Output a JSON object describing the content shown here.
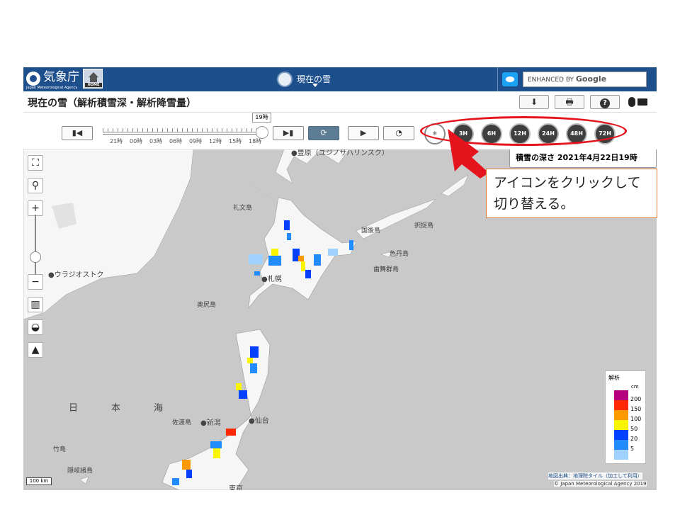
{
  "header": {
    "agency_name": "気象庁",
    "agency_sub": "Japan Meteorological Agency",
    "home_label": "HOME",
    "center_title": "現在の雪",
    "search_prefix": "ENHANCED BY",
    "search_brand": "Google"
  },
  "titlebar": {
    "page_title": "現在の雪（解析積雪深・解析降雪量）",
    "download_icon": "⬇",
    "print_icon": "🖶",
    "help_icon": "?"
  },
  "timebar": {
    "current_time_label": "19時",
    "tick_labels": [
      "21時",
      "00時",
      "03時",
      "06時",
      "09時",
      "12時",
      "15時",
      "18時"
    ],
    "content_buttons": [
      "",
      "3H",
      "6H",
      "12H",
      "24H",
      "48H",
      "72H"
    ]
  },
  "map": {
    "info_box": "積雪の深さ 2021年4月22日19時",
    "places": {
      "toyohara": "●豊原（ユジノサハリンスク）",
      "rebun": "礼文島",
      "kunashiri": "国後島",
      "etorofu": "択捉島",
      "shikotan": "色丹島",
      "habomai": "歯舞群島",
      "vladivostok": "●ウラジオストク",
      "sapporo": "●札幌",
      "okushiri": "奥尻島",
      "sado": "佐渡島",
      "niigata": "●新潟",
      "sendai": "●仙台",
      "takeshima": "竹島",
      "oki": "隠岐諸島",
      "tokyo": "東京"
    },
    "sea_name": [
      "日",
      "本",
      "海"
    ],
    "scale": "100 km",
    "credit": "地図出典：地理院タイル（加工して利用）",
    "copyright": "© Japan Meteorological Agency 2019"
  },
  "legend": {
    "title": "解析",
    "unit": "cm",
    "levels": [
      {
        "label": "200",
        "color": "#b4007d"
      },
      {
        "label": "150",
        "color": "#ff2800"
      },
      {
        "label": "100",
        "color": "#ff9900"
      },
      {
        "label": "50",
        "color": "#faf500"
      },
      {
        "label": "20",
        "color": "#0041ff"
      },
      {
        "label": "5",
        "color": "#218cff"
      },
      {
        "label": "",
        "color": "#a0d2ff"
      }
    ]
  },
  "annotation": {
    "callout_text": "アイコンをクリックして切り替える。"
  },
  "colors": {
    "header_blue": "#1d4f8c",
    "highlight_red": "#e5131c",
    "callout_border": "#e07a38"
  }
}
